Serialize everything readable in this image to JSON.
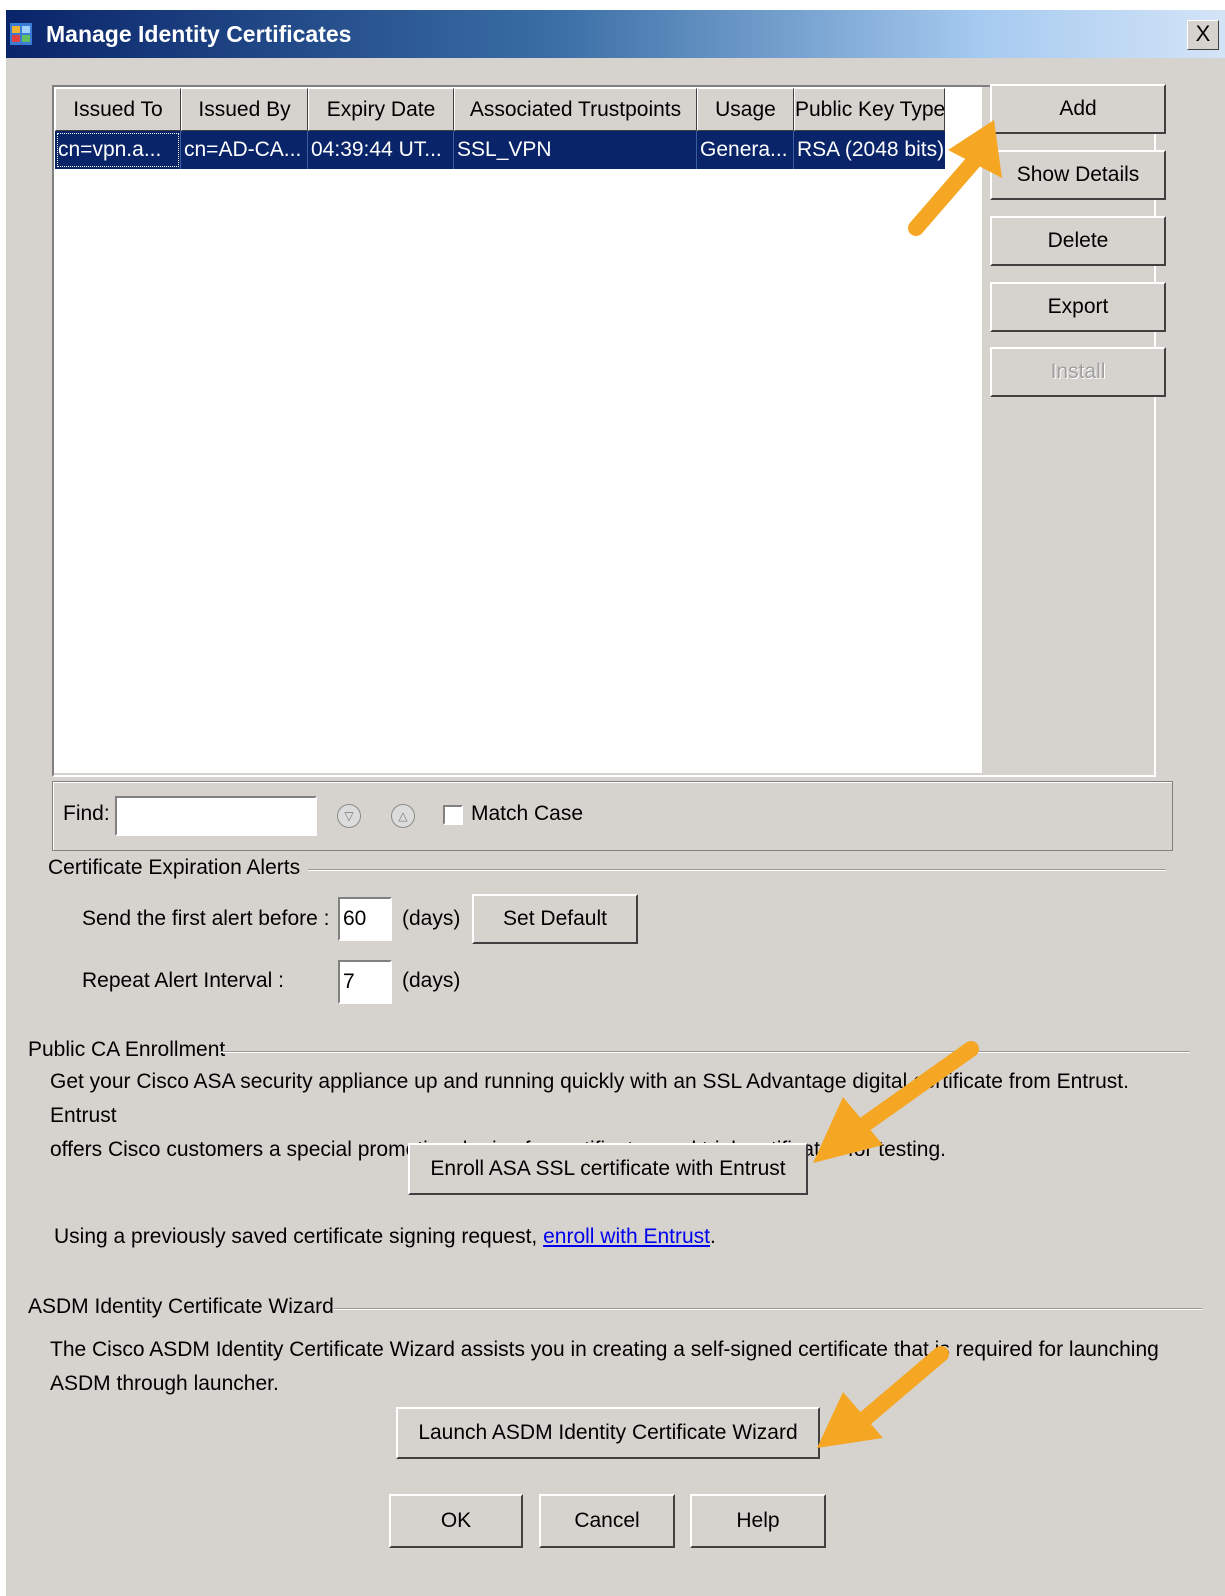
{
  "window": {
    "title": "Manage Identity Certificates",
    "close_glyph": "X"
  },
  "table": {
    "columns": [
      "Issued To",
      "Issued By",
      "Expiry Date",
      "Associated Trustpoints",
      "Usage",
      "Public Key Type"
    ],
    "rows": [
      [
        "cn=vpn.a...",
        "cn=AD-CA...",
        "04:39:44 UT...",
        "SSL_VPN",
        "Genera...",
        "RSA (2048 bits)"
      ]
    ]
  },
  "side_buttons": {
    "add": "Add",
    "show_details": "Show Details",
    "delete": "Delete",
    "export": "Export",
    "install": "Install"
  },
  "find": {
    "label": "Find:",
    "value": "",
    "match_case": "Match Case"
  },
  "alerts": {
    "heading": "Certificate Expiration Alerts",
    "first_label": "Send the first alert before :",
    "first_value": "60",
    "first_unit": "(days)",
    "set_default": "Set Default",
    "repeat_label": "Repeat Alert Interval :",
    "repeat_value": "7",
    "repeat_unit": "(days)"
  },
  "public_ca": {
    "heading": "Public CA Enrollment",
    "text_line1": "Get your Cisco ASA security appliance up and running quickly with an SSL Advantage digital certificate from Entrust. Entrust",
    "text_line2": "offers Cisco customers a special promotional price for certificates and trial certificates for testing.",
    "enroll_button": "Enroll ASA SSL certificate with Entrust",
    "csr_text": "Using a previously saved certificate signing request,",
    "csr_link": "enroll with Entrust",
    "csr_end": "."
  },
  "wizard": {
    "heading": "ASDM Identity Certificate Wizard",
    "text_line1": "The Cisco ASDM Identity Certificate Wizard assists you in creating a self-signed certificate that is required for launching",
    "text_line2": "ASDM through launcher.",
    "launch_button": "Launch ASDM Identity Certificate Wizard"
  },
  "footer": {
    "ok": "OK",
    "cancel": "Cancel",
    "help": "Help"
  },
  "colors": {
    "selection": "#0a246a",
    "dialog_bg": "#d6d3ce",
    "arrow": "#f5a623"
  },
  "icons": [
    "app-icon",
    "close-icon",
    "find-next-icon",
    "find-previous-icon",
    "annotation-arrow-icon"
  ]
}
